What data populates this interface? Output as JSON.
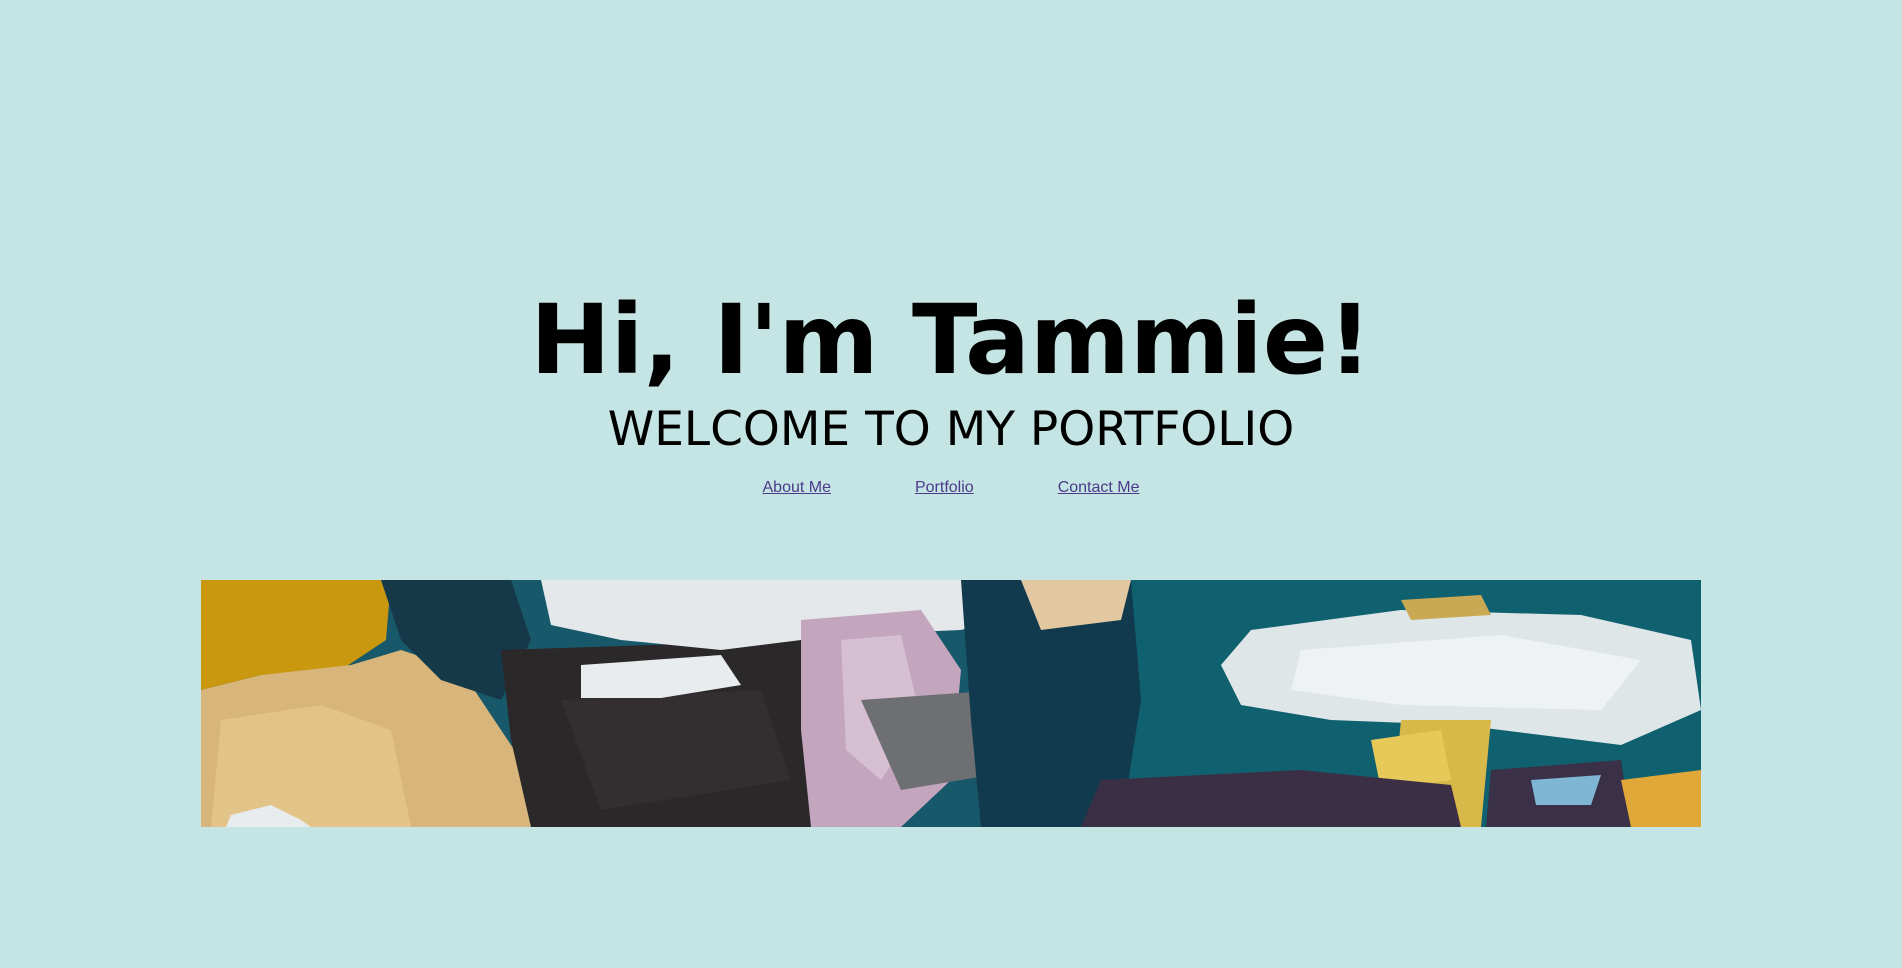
{
  "hero": {
    "title": "Hi, I'm Tammie!",
    "subtitle": "WELCOME TO MY PORTFOLIO"
  },
  "nav": {
    "links": [
      {
        "label": "About Me"
      },
      {
        "label": "Portfolio"
      },
      {
        "label": "Contact Me"
      }
    ]
  },
  "colors": {
    "background": "#c5e5e5",
    "link": "#4b3a8a",
    "text": "#000000"
  }
}
